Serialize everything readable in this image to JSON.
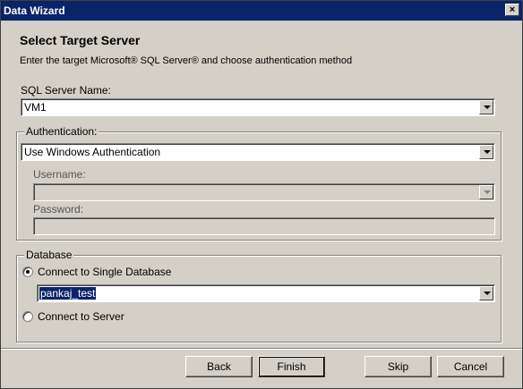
{
  "window": {
    "title": "Data Wizard",
    "close_glyph": "×"
  },
  "header": {
    "title": "Select Target Server",
    "subtitle": "Enter the target Microsoft® SQL Server® and choose authentication method"
  },
  "server": {
    "label": "SQL Server Name:",
    "value": "VM1"
  },
  "authentication": {
    "group_label": "Authentication:",
    "method": "Use Windows Authentication",
    "username_label": "Username:",
    "username_value": "",
    "password_label": "Password:",
    "password_value": ""
  },
  "database": {
    "group_label": "Database",
    "option_single": "Connect to Single Database",
    "database_value": "pankaj_test",
    "option_server": "Connect to Server",
    "selected": "single"
  },
  "buttons": {
    "back": "Back",
    "finish": "Finish",
    "skip": "Skip",
    "cancel": "Cancel"
  },
  "colors": {
    "titlebar": "#0a246a",
    "dialog_bg": "#d4d0c8",
    "selection": "#0a246a"
  }
}
